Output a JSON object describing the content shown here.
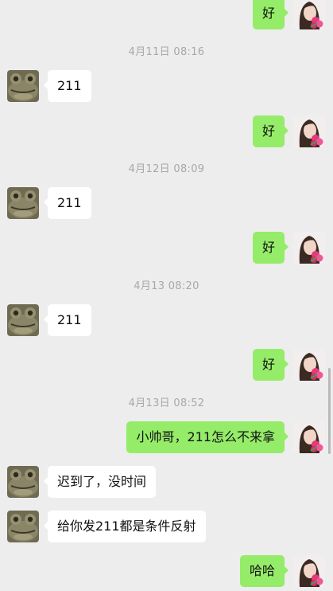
{
  "chat": {
    "timestamps": [
      "4月11日 08:16",
      "4月12日 08:09",
      "4月13 08:20",
      "4月13日 08:52"
    ],
    "messages": [
      {
        "side": "out",
        "text": "好"
      },
      {
        "side": "in",
        "text": "211"
      },
      {
        "side": "out",
        "text": "好"
      },
      {
        "side": "in",
        "text": "211"
      },
      {
        "side": "out",
        "text": "好"
      },
      {
        "side": "in",
        "text": "211"
      },
      {
        "side": "out",
        "text": "好"
      },
      {
        "side": "out",
        "text": "小帅哥，211怎么不来拿"
      },
      {
        "side": "in",
        "text": "迟到了，没时间"
      },
      {
        "side": "in",
        "text": "给你发211都是条件反射"
      },
      {
        "side": "out",
        "text": "哈哈"
      }
    ]
  },
  "colors": {
    "background": "#ededed",
    "incoming_bubble": "#ffffff",
    "outgoing_bubble": "#95ec69",
    "timestamp_text": "#a8a8a8"
  },
  "icons": {
    "incoming_avatar": "frog-avatar",
    "outgoing_avatar": "girl-with-flowers-avatar"
  }
}
